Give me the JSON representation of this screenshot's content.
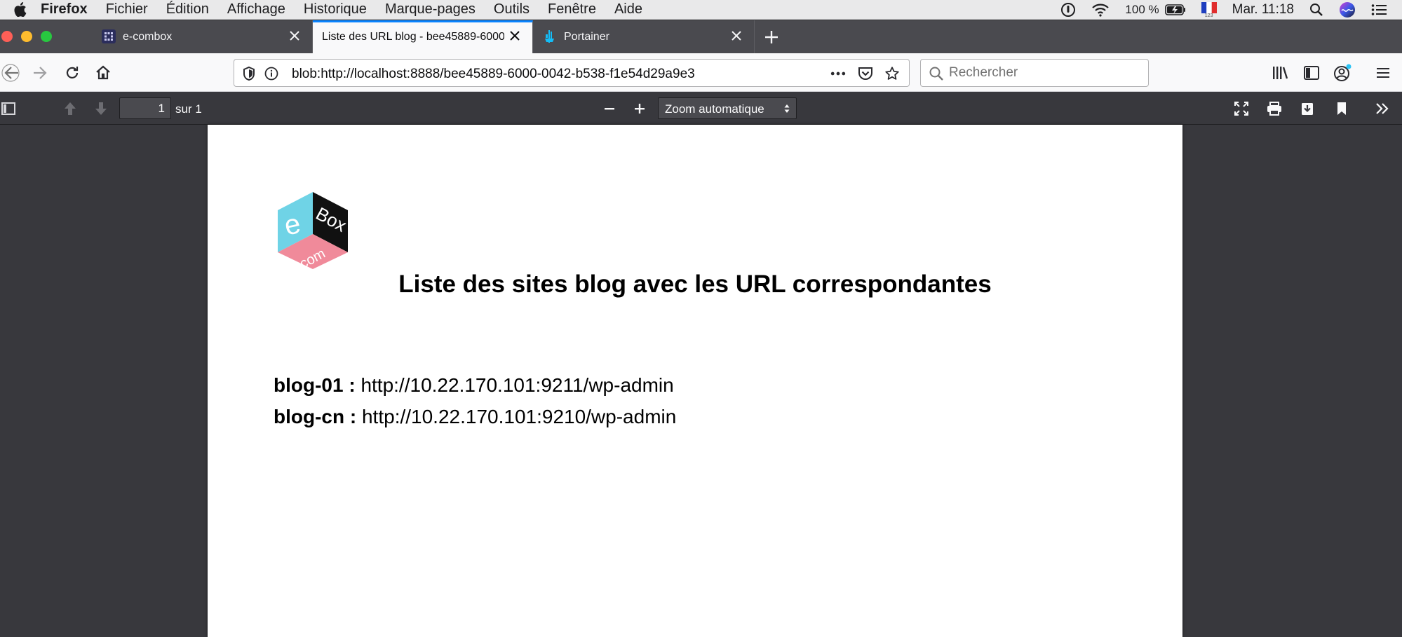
{
  "menubar": {
    "app_name": "Firefox",
    "items": [
      "Fichier",
      "Édition",
      "Affichage",
      "Historique",
      "Marque-pages",
      "Outils",
      "Fenêtre",
      "Aide"
    ],
    "battery": "100 %",
    "keyboard_layout": "123",
    "clock": "Mar. 11:18"
  },
  "tabs": [
    {
      "label": "e-combox",
      "active": false
    },
    {
      "label": "Liste des URL blog - bee45889-6000",
      "active": true
    },
    {
      "label": "Portainer",
      "active": false
    }
  ],
  "navbar": {
    "url": "blob:http://localhost:8888/bee45889-6000-0042-b538-f1e54d29a9e3",
    "search_placeholder": "Rechercher"
  },
  "pdf_toolbar": {
    "page_number": "1",
    "page_of": "sur 1",
    "zoom": "Zoom automatique"
  },
  "document": {
    "logo_letters": [
      "e",
      "Box",
      "com"
    ],
    "title": "Liste des sites blog avec les URL correspondantes",
    "entries": [
      {
        "name": "blog-01 :",
        "url": "http://10.22.170.101:9211/wp-admin"
      },
      {
        "name": "blog-cn :",
        "url": "http://10.22.170.101:9210/wp-admin"
      }
    ]
  },
  "colors": {
    "tab_strip": "#4a4a4f",
    "active_tab_accent": "#0a84ff",
    "pdf_background": "#38383d",
    "logo_cyan": "#6fd3e6",
    "logo_black": "#111111",
    "logo_pink": "#f08a9a"
  }
}
